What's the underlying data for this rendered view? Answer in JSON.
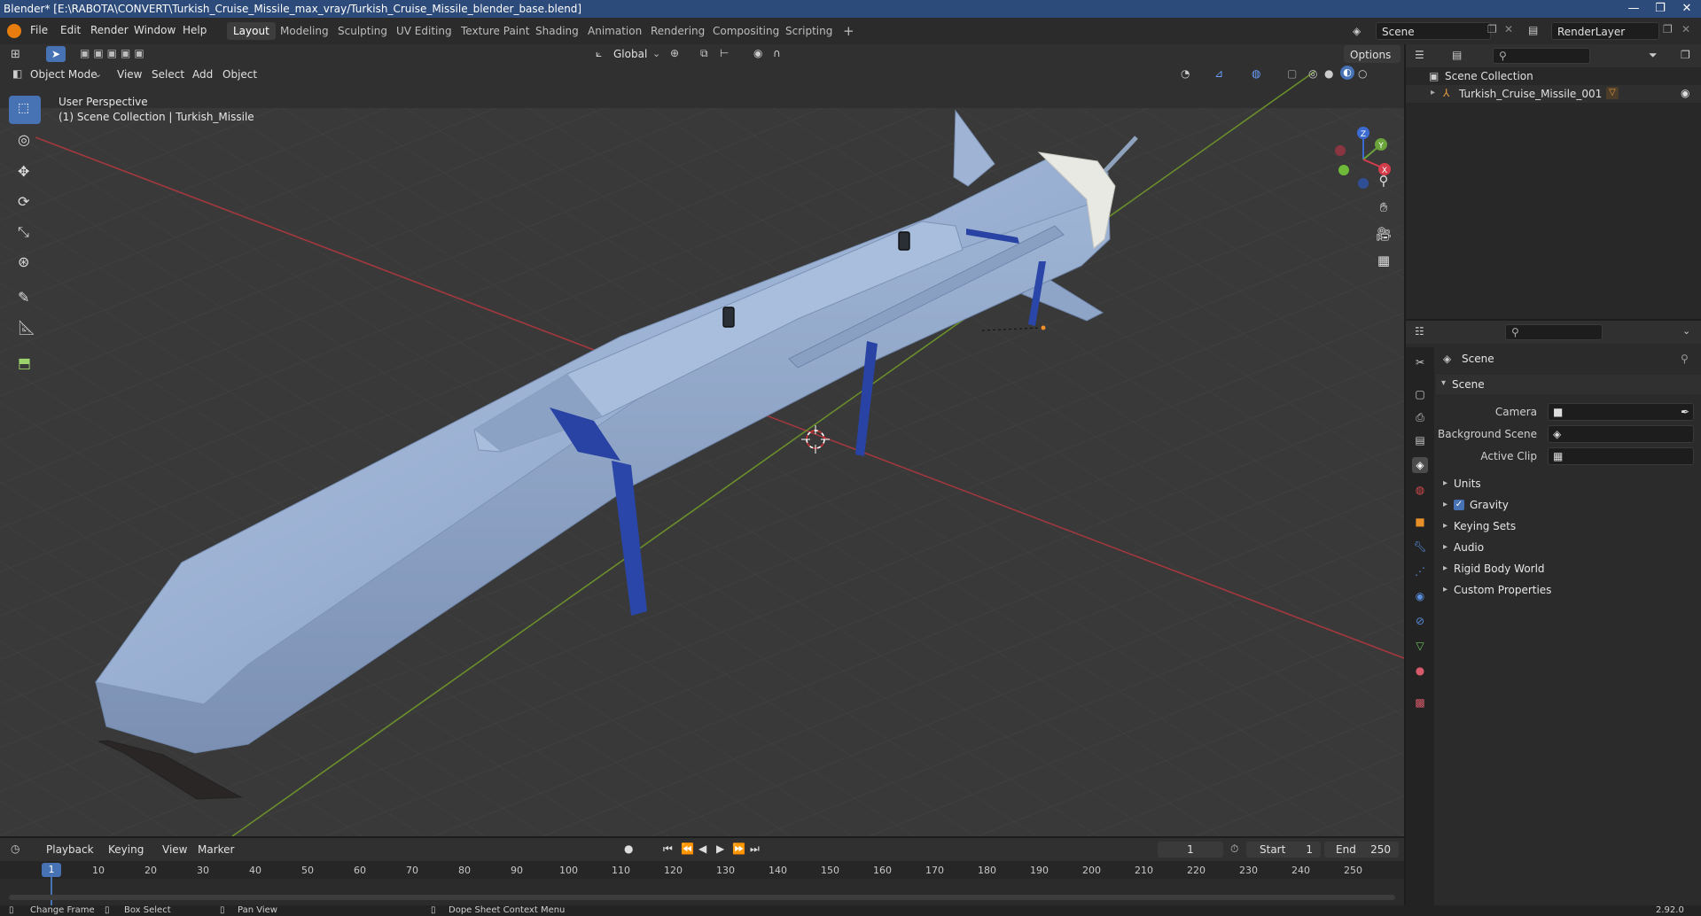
{
  "window": {
    "title": "Blender* [E:\\RABOTA\\CONVERT\\Turkish_Cruise_Missile_max_vray/Turkish_Cruise_Missile_blender_base.blend]",
    "min_glyph": "—",
    "max_glyph": "❐",
    "close_glyph": "✕"
  },
  "menus": [
    "File",
    "Edit",
    "Render",
    "Window",
    "Help"
  ],
  "workspaces": [
    "Layout",
    "Modeling",
    "Sculpting",
    "UV Editing",
    "Texture Paint",
    "Shading",
    "Animation",
    "Rendering",
    "Compositing",
    "Scripting"
  ],
  "add_workspace": "+",
  "scene_field": "Scene",
  "renderlayer_field": "RenderLayer",
  "tool_header": {
    "orientation": "Global",
    "options": "Options"
  },
  "viewport_header": {
    "mode": "Object Mode",
    "menus": [
      "View",
      "Select",
      "Add",
      "Object"
    ]
  },
  "viewport": {
    "perspective": "User Perspective",
    "collection": "(1) Scene Collection | Turkish_Missile",
    "gizmo": {
      "z": "Z",
      "y": "Y",
      "x": "X"
    }
  },
  "outliner": {
    "root": "Scene Collection",
    "items": [
      {
        "label": "Turkish_Cruise_Missile_001"
      }
    ]
  },
  "properties": {
    "context": "Scene",
    "panel": "Scene",
    "fields": [
      {
        "label": "Camera",
        "value": ""
      },
      {
        "label": "Background Scene",
        "value": ""
      },
      {
        "label": "Active Clip",
        "value": ""
      }
    ],
    "subpanels": [
      "Units",
      "Gravity",
      "Keying Sets",
      "Audio",
      "Rigid Body World",
      "Custom Properties"
    ],
    "gravity_checked": true
  },
  "timeline": {
    "menus": [
      "Playback",
      "Keying",
      "View",
      "Marker"
    ],
    "current_frame": "1",
    "start_label": "Start",
    "start": "1",
    "end_label": "End",
    "end": "250",
    "ticks": [
      "10",
      "20",
      "30",
      "40",
      "50",
      "60",
      "70",
      "80",
      "90",
      "100",
      "110",
      "120",
      "130",
      "140",
      "150",
      "160",
      "170",
      "180",
      "190",
      "200",
      "210",
      "220",
      "230",
      "240",
      "250"
    ],
    "playhead": "1"
  },
  "statusbar": {
    "items": [
      "Change Frame",
      "Box Select",
      "Pan View",
      "Dope Sheet Context Menu"
    ],
    "version": "2.92.0"
  },
  "colors": {
    "accent": "#4772b3",
    "x_axis": "#b03a40",
    "y_axis": "#6a8f2a",
    "missile": "#9bb3d3",
    "band": "#2843a3"
  }
}
